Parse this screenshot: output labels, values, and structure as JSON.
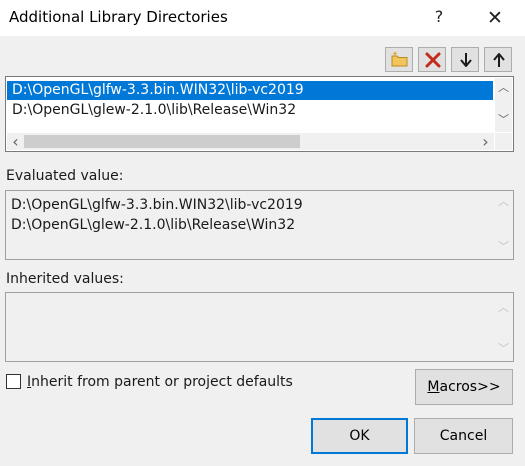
{
  "window": {
    "title": "Additional Library Directories",
    "help_glyph": "?",
    "close_glyph": "✕"
  },
  "toolbar": {
    "new_line_icon": "folder-new-icon",
    "delete_icon": "delete-x-icon",
    "move_down_icon": "arrow-down-icon",
    "move_up_icon": "arrow-up-icon"
  },
  "directories": {
    "items": [
      "D:\\OpenGL\\glfw-3.3.bin.WIN32\\lib-vc2019",
      "D:\\OpenGL\\glew-2.1.0\\lib\\Release\\Win32"
    ],
    "selected_index": 0
  },
  "evaluated": {
    "label": "Evaluated value:",
    "lines": [
      "D:\\OpenGL\\glfw-3.3.bin.WIN32\\lib-vc2019",
      "D:\\OpenGL\\glew-2.1.0\\lib\\Release\\Win32"
    ]
  },
  "inherited": {
    "label": "Inherited values:"
  },
  "inherit_checkbox": {
    "mnemonic": "I",
    "label_rest": "nherit from parent or project defaults",
    "checked": false
  },
  "buttons": {
    "macros_mnemonic": "M",
    "macros_rest": "acros>>",
    "ok": "OK",
    "cancel": "Cancel"
  },
  "scroll_glyphs": {
    "up": "︿",
    "down": "﹀",
    "left": "‹",
    "right": "›"
  },
  "colors": {
    "selection": "#0078d7",
    "dialog_bg": "#f0f0f0",
    "delete_red": "#c42b1c",
    "folder_yellow": "#f2c55c"
  }
}
